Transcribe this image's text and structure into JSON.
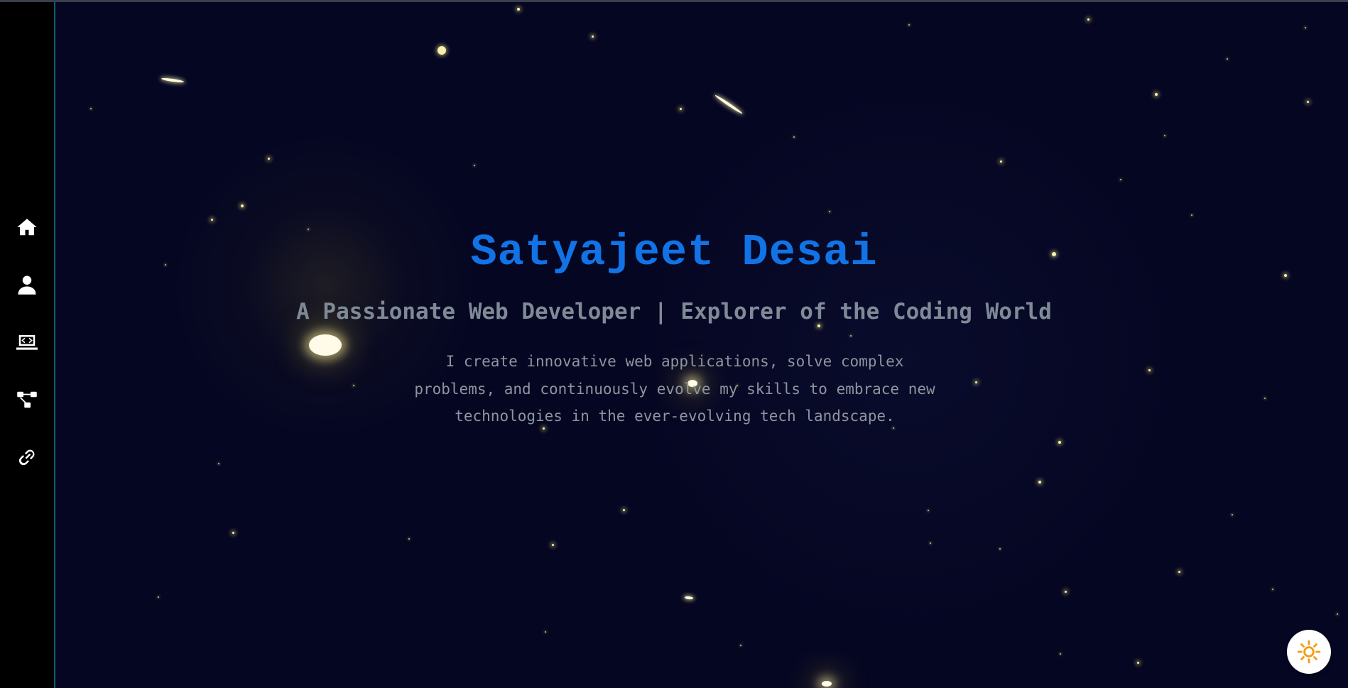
{
  "sidebar": {
    "items": [
      {
        "icon": "home-icon",
        "label": "Home"
      },
      {
        "icon": "user-icon",
        "label": "About"
      },
      {
        "icon": "laptop-code-icon",
        "label": "Projects"
      },
      {
        "icon": "diagram-icon",
        "label": "Skills"
      },
      {
        "icon": "link-icon",
        "label": "Contact"
      }
    ]
  },
  "hero": {
    "title": "Satyajeet Desai",
    "subtitle": "A Passionate Web Developer | Explorer of the Coding World",
    "description": "I create innovative web applications, solve complex problems, and continuously evolve my skills to embrace new technologies in the ever-evolving tech landscape."
  },
  "theme_toggle": {
    "icon": "sun-icon",
    "color": "#f39c12"
  },
  "colors": {
    "background": "#050622",
    "sidebar": "#000000",
    "title": "#1173e6",
    "subtitle": "#7f8a96",
    "text": "#8e959f"
  }
}
